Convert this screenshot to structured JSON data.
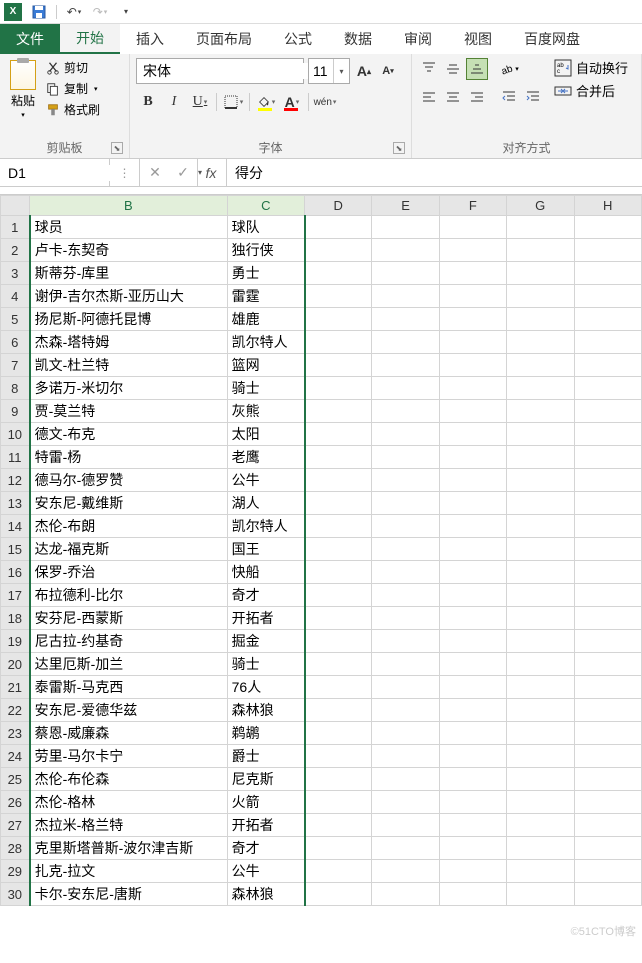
{
  "qat": {
    "save": "💾",
    "undo": "↶",
    "redo": "↷"
  },
  "tabs": {
    "file": "文件",
    "home": "开始",
    "insert": "插入",
    "layout": "页面布局",
    "formula": "公式",
    "data": "数据",
    "review": "审阅",
    "view": "视图",
    "baidu": "百度网盘"
  },
  "ribbon": {
    "clipboard": {
      "paste": "粘贴",
      "cut": "剪切",
      "copy": "复制",
      "format_painter": "格式刷",
      "group": "剪贴板"
    },
    "font": {
      "name": "宋体",
      "size": "11",
      "group": "字体",
      "phonetic": "wén"
    },
    "align": {
      "wrap": "自动换行",
      "merge": "合并后",
      "group": "对齐方式"
    }
  },
  "namebox": "D1",
  "formula": "得分",
  "columns": [
    "B",
    "C",
    "D",
    "E",
    "F",
    "G",
    "H"
  ],
  "chart_data": {
    "type": "table",
    "headers": [
      "球员",
      "球队"
    ],
    "rows": [
      [
        "卢卡-东契奇",
        "独行侠"
      ],
      [
        "斯蒂芬-库里",
        "勇士"
      ],
      [
        "谢伊-吉尔杰斯-亚历山大",
        "雷霆"
      ],
      [
        "扬尼斯-阿德托昆博",
        "雄鹿"
      ],
      [
        "杰森-塔特姆",
        "凯尔特人"
      ],
      [
        "凯文-杜兰特",
        "篮网"
      ],
      [
        "多诺万-米切尔",
        "骑士"
      ],
      [
        "贾-莫兰特",
        "灰熊"
      ],
      [
        "德文-布克",
        "太阳"
      ],
      [
        "特雷-杨",
        "老鹰"
      ],
      [
        "德马尔-德罗赞",
        "公牛"
      ],
      [
        "安东尼-戴维斯",
        "湖人"
      ],
      [
        "杰伦-布朗",
        "凯尔特人"
      ],
      [
        "达龙-福克斯",
        "国王"
      ],
      [
        "保罗-乔治",
        "快船"
      ],
      [
        "布拉德利-比尔",
        "奇才"
      ],
      [
        "安芬尼-西蒙斯",
        "开拓者"
      ],
      [
        "尼古拉-约基奇",
        "掘金"
      ],
      [
        "达里厄斯-加兰",
        "骑士"
      ],
      [
        "泰雷斯-马克西",
        "76人"
      ],
      [
        "安东尼-爱德华兹",
        "森林狼"
      ],
      [
        "蔡恩-威廉森",
        "鹈鹕"
      ],
      [
        "劳里-马尔卡宁",
        "爵士"
      ],
      [
        "杰伦-布伦森",
        "尼克斯"
      ],
      [
        "杰伦-格林",
        "火箭"
      ],
      [
        "杰拉米-格兰特",
        "开拓者"
      ],
      [
        "克里斯塔普斯-波尔津吉斯",
        "奇才"
      ],
      [
        "扎克-拉文",
        "公牛"
      ],
      [
        "卡尔-安东尼-唐斯",
        "森林狼"
      ]
    ]
  },
  "watermark": "©51CTO博客"
}
